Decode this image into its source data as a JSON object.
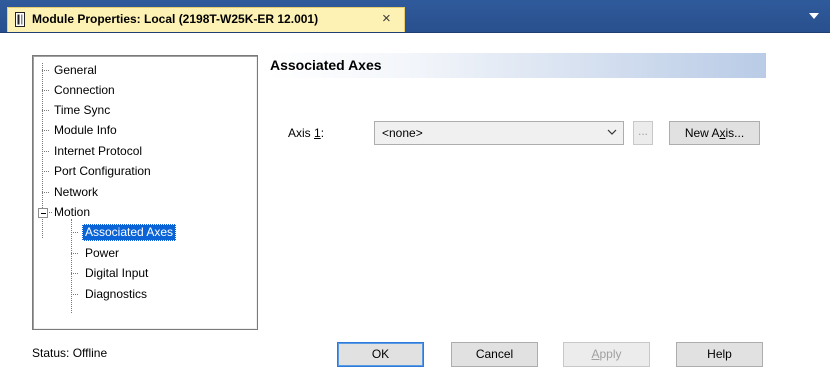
{
  "window": {
    "title": "Module Properties: Local (2198T-W25K-ER 12.001)",
    "close_glyph": "×",
    "title_bar_color": "#2b5797",
    "tab_color": "#fdf1b3"
  },
  "tree": {
    "items": [
      {
        "label": "General"
      },
      {
        "label": "Connection"
      },
      {
        "label": "Time Sync"
      },
      {
        "label": "Module Info"
      },
      {
        "label": "Internet Protocol"
      },
      {
        "label": "Port Configuration"
      },
      {
        "label": "Network"
      },
      {
        "label": "Motion",
        "expanded": true
      },
      {
        "label": "Associated Axes",
        "selected": true
      },
      {
        "label": "Power"
      },
      {
        "label": "Digital Input"
      },
      {
        "label": "Diagnostics"
      }
    ],
    "selected_color": "#0a64d8"
  },
  "page": {
    "title": "Associated Axes",
    "axis_label_prefix": "Axis ",
    "axis_label_mnemonic": "1",
    "axis_label_suffix": ":",
    "axis_value": "<none>",
    "browse_label": "...",
    "new_axis_label_prefix": "New A",
    "new_axis_label_mnemonic": "x",
    "new_axis_label_suffix": "is..."
  },
  "footer": {
    "status": "Status:  Offline",
    "ok_label": "OK",
    "cancel_label": "Cancel",
    "apply_label": "Apply",
    "apply_mnemonic": "A",
    "apply_rest": "pply",
    "help_label": "Help"
  }
}
